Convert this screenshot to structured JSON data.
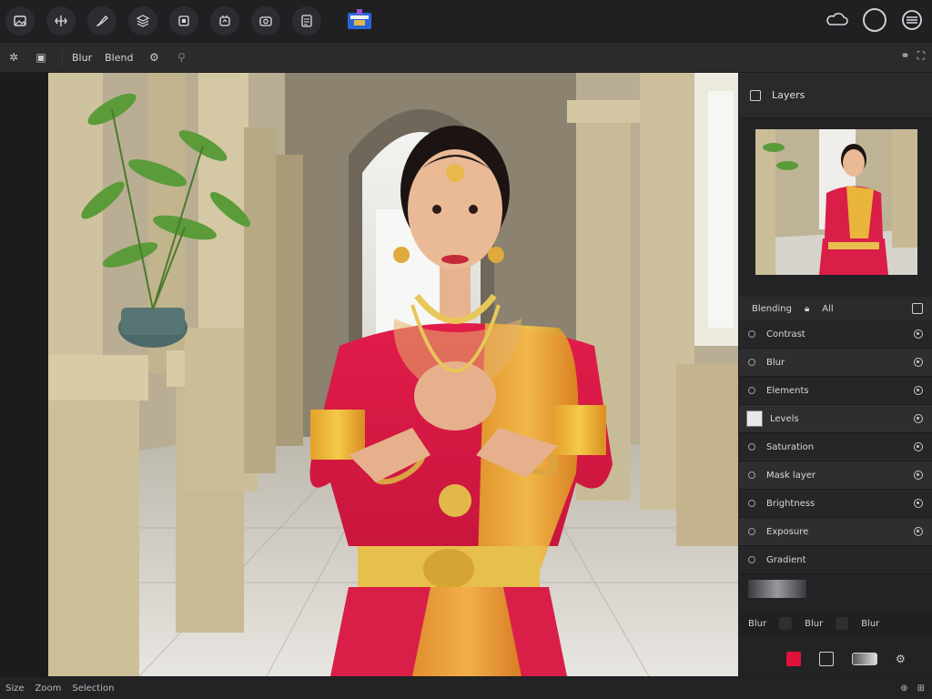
{
  "toolbar": {
    "tools": [
      {
        "icon": "image-icon"
      },
      {
        "icon": "transform-icon"
      },
      {
        "icon": "brush-icon"
      },
      {
        "icon": "layers-icon"
      },
      {
        "icon": "crop-icon"
      },
      {
        "icon": "adjust-icon"
      },
      {
        "icon": "filter-icon"
      },
      {
        "icon": "export-icon"
      }
    ],
    "brand_icon": "app-logo-icon",
    "right": [
      {
        "icon": "cloud-icon"
      },
      {
        "icon": "profile-circle-icon"
      },
      {
        "icon": "menu-icon"
      }
    ]
  },
  "subbar": {
    "items": [
      "Blur",
      "Blend"
    ]
  },
  "panel": {
    "title": "Layers",
    "tabs": [
      "Blending",
      "All"
    ],
    "layers": [
      {
        "label": "Contrast"
      },
      {
        "label": "Blur"
      },
      {
        "label": "Elements"
      },
      {
        "label": "Levels"
      },
      {
        "label": "Saturation"
      },
      {
        "label": "Mask layer"
      },
      {
        "label": "Brightness"
      },
      {
        "label": "Exposure"
      },
      {
        "label": "Gradient"
      }
    ],
    "footer": [
      "Blur",
      "Blur",
      "Blur"
    ]
  },
  "status": {
    "items": [
      "Size",
      "Zoom",
      "Selection"
    ]
  },
  "colors": {
    "accent": "#e0123a",
    "canvas_bg": "#d9d1bd"
  }
}
